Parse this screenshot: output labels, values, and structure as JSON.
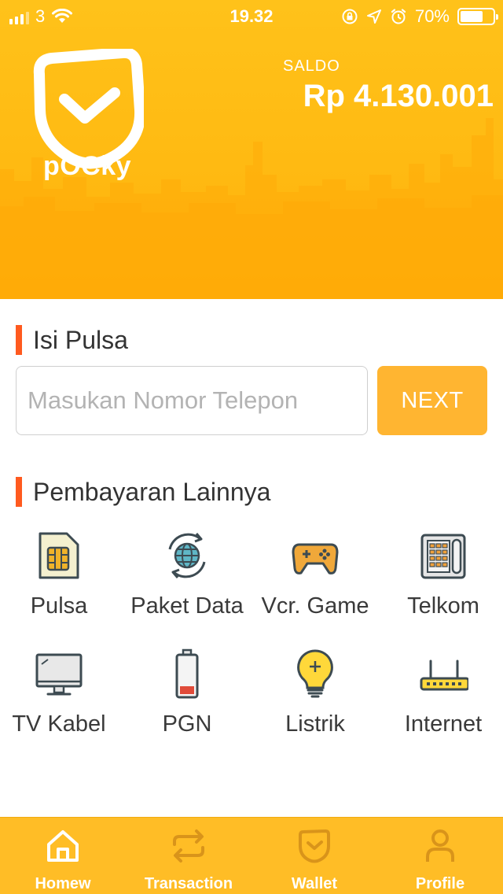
{
  "status_bar": {
    "carrier": "3",
    "time": "19.32",
    "battery_text": "70%",
    "battery_level": 0.7,
    "icons": [
      "signal-icon",
      "wifi-icon",
      "lock-rotation-icon",
      "location-icon",
      "alarm-icon",
      "battery-icon"
    ]
  },
  "header": {
    "brand": "pOCky",
    "saldo_label": "SALDO",
    "saldo_amount": "Rp 4.130.001"
  },
  "isi_pulsa": {
    "title": "Isi Pulsa",
    "placeholder": "Masukan Nomor Telepon",
    "value": "",
    "next_label": "NEXT"
  },
  "pembayaran": {
    "title": "Pembayaran Lainnya",
    "items": [
      {
        "label": "Pulsa",
        "icon": "sim-card-icon"
      },
      {
        "label": "Paket Data",
        "icon": "globe-sync-icon"
      },
      {
        "label": "Vcr. Game",
        "icon": "gamepad-icon"
      },
      {
        "label": "Telkom",
        "icon": "telephone-icon"
      },
      {
        "label": "TV Kabel",
        "icon": "monitor-icon"
      },
      {
        "label": "PGN",
        "icon": "battery-low-icon"
      },
      {
        "label": "Listrik",
        "icon": "lightbulb-icon"
      },
      {
        "label": "Internet",
        "icon": "router-icon"
      }
    ]
  },
  "bottom_nav": {
    "items": [
      {
        "label": "Homew",
        "icon": "home-icon",
        "active": true
      },
      {
        "label": "Transaction",
        "icon": "transfer-icon",
        "active": false
      },
      {
        "label": "Wallet",
        "icon": "wallet-icon",
        "active": false
      },
      {
        "label": "Profile",
        "icon": "user-icon",
        "active": false
      }
    ]
  },
  "colors": {
    "header_yellow": "#ffbd1a",
    "accent_orange": "#ff5a1f",
    "next_button": "#ffb531",
    "nav_bar": "#ffbd26",
    "nav_icon_inactive": "#d9941a"
  }
}
